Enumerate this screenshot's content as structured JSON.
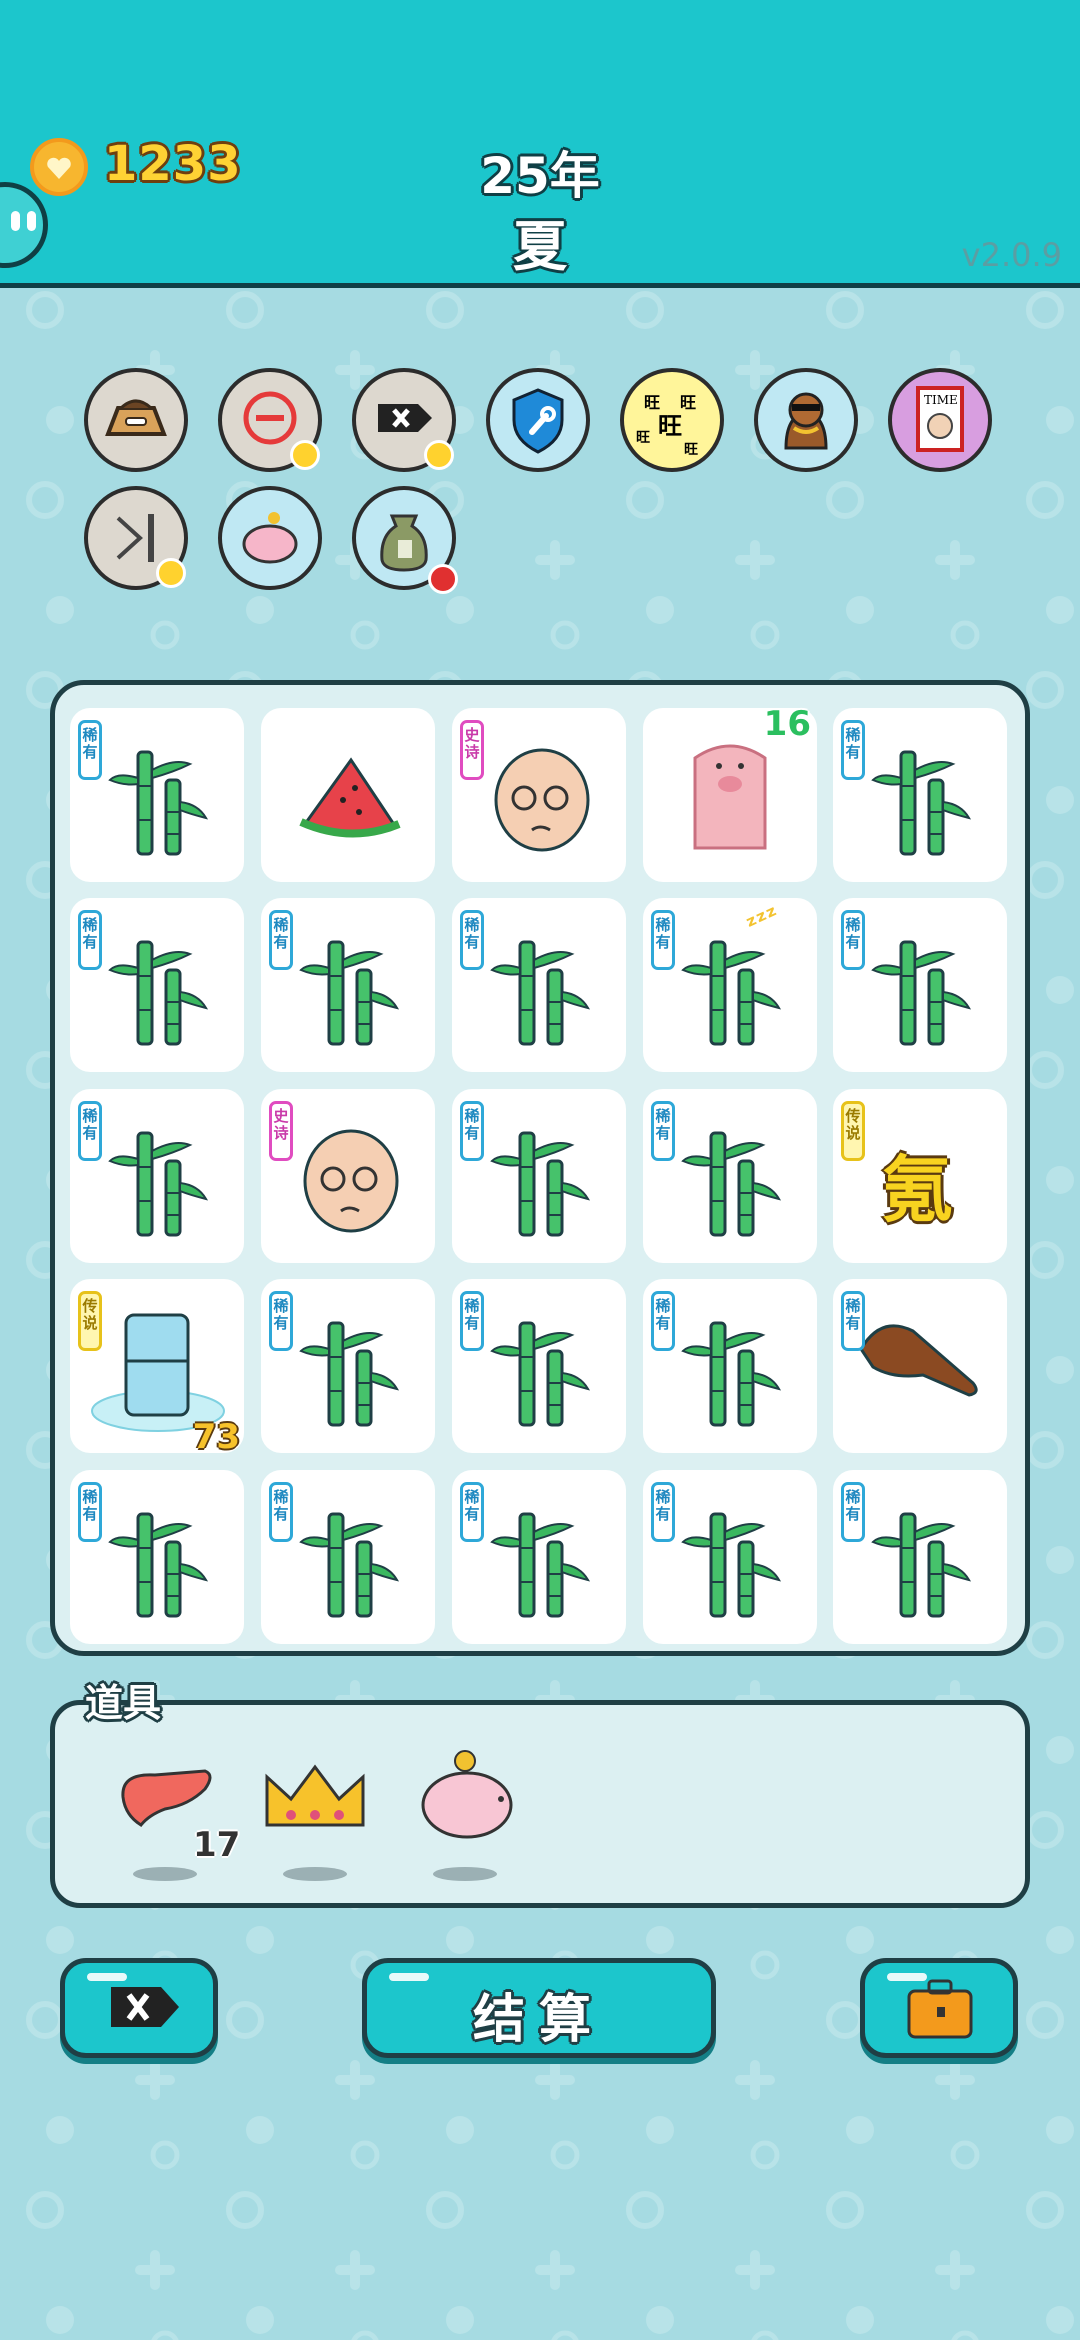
{
  "header": {
    "coins": "1233",
    "year": "25年",
    "season": "夏",
    "version": "v2.0.9"
  },
  "buffs": [
    {
      "name": "pet-food-bowl-icon"
    },
    {
      "name": "remove-symbol-icon"
    },
    {
      "name": "delete-tag-icon"
    },
    {
      "name": "shield-wrench-icon"
    },
    {
      "name": "wang-characters-icon"
    },
    {
      "name": "cool-dog-icon"
    },
    {
      "name": "time-magazine-icon"
    },
    {
      "name": "skip-forward-icon"
    },
    {
      "name": "piggy-bank-icon"
    },
    {
      "name": "money-sack-icon"
    }
  ],
  "board": {
    "tags": {
      "rare": "稀有",
      "epic": "史诗",
      "legend": "传说"
    },
    "tiles": [
      {
        "symbol": "bamboo",
        "rarity": "rare"
      },
      {
        "symbol": "watermelon",
        "rarity": ""
      },
      {
        "symbol": "old-man",
        "rarity": "epic"
      },
      {
        "symbol": "pig-totem",
        "rarity": "",
        "count": "16"
      },
      {
        "symbol": "bamboo",
        "rarity": "rare"
      },
      {
        "symbol": "bamboo",
        "rarity": "rare"
      },
      {
        "symbol": "bamboo",
        "rarity": "rare"
      },
      {
        "symbol": "bamboo",
        "rarity": "rare"
      },
      {
        "symbol": "bamboo",
        "rarity": "rare",
        "sleeping": true
      },
      {
        "symbol": "bamboo",
        "rarity": "rare"
      },
      {
        "symbol": "bamboo",
        "rarity": "rare"
      },
      {
        "symbol": "old-man",
        "rarity": "epic"
      },
      {
        "symbol": "bamboo",
        "rarity": "rare"
      },
      {
        "symbol": "bamboo",
        "rarity": "rare"
      },
      {
        "symbol": "chinese-char",
        "rarity": "legend",
        "char": "氪"
      },
      {
        "symbol": "fridge",
        "rarity": "legend",
        "count": "73"
      },
      {
        "symbol": "bamboo",
        "rarity": "rare"
      },
      {
        "symbol": "bamboo",
        "rarity": "rare"
      },
      {
        "symbol": "bamboo",
        "rarity": "rare"
      },
      {
        "symbol": "pointing-hand",
        "rarity": "rare"
      },
      {
        "symbol": "bamboo",
        "rarity": "rare"
      },
      {
        "symbol": "bamboo",
        "rarity": "rare"
      },
      {
        "symbol": "bamboo",
        "rarity": "rare"
      },
      {
        "symbol": "bamboo",
        "rarity": "rare"
      },
      {
        "symbol": "bamboo",
        "rarity": "rare"
      }
    ]
  },
  "items": {
    "title": "道具",
    "list": [
      {
        "name": "liver-item",
        "count": "17"
      },
      {
        "name": "crown-item",
        "count": ""
      },
      {
        "name": "piggy-bank-item",
        "count": ""
      }
    ]
  },
  "actions": {
    "settle_label": "结算"
  },
  "colors": {
    "header": "#1cc6cc",
    "background": "#a6dbe2",
    "outline": "#1f3f45",
    "coin": "#ffd234"
  }
}
